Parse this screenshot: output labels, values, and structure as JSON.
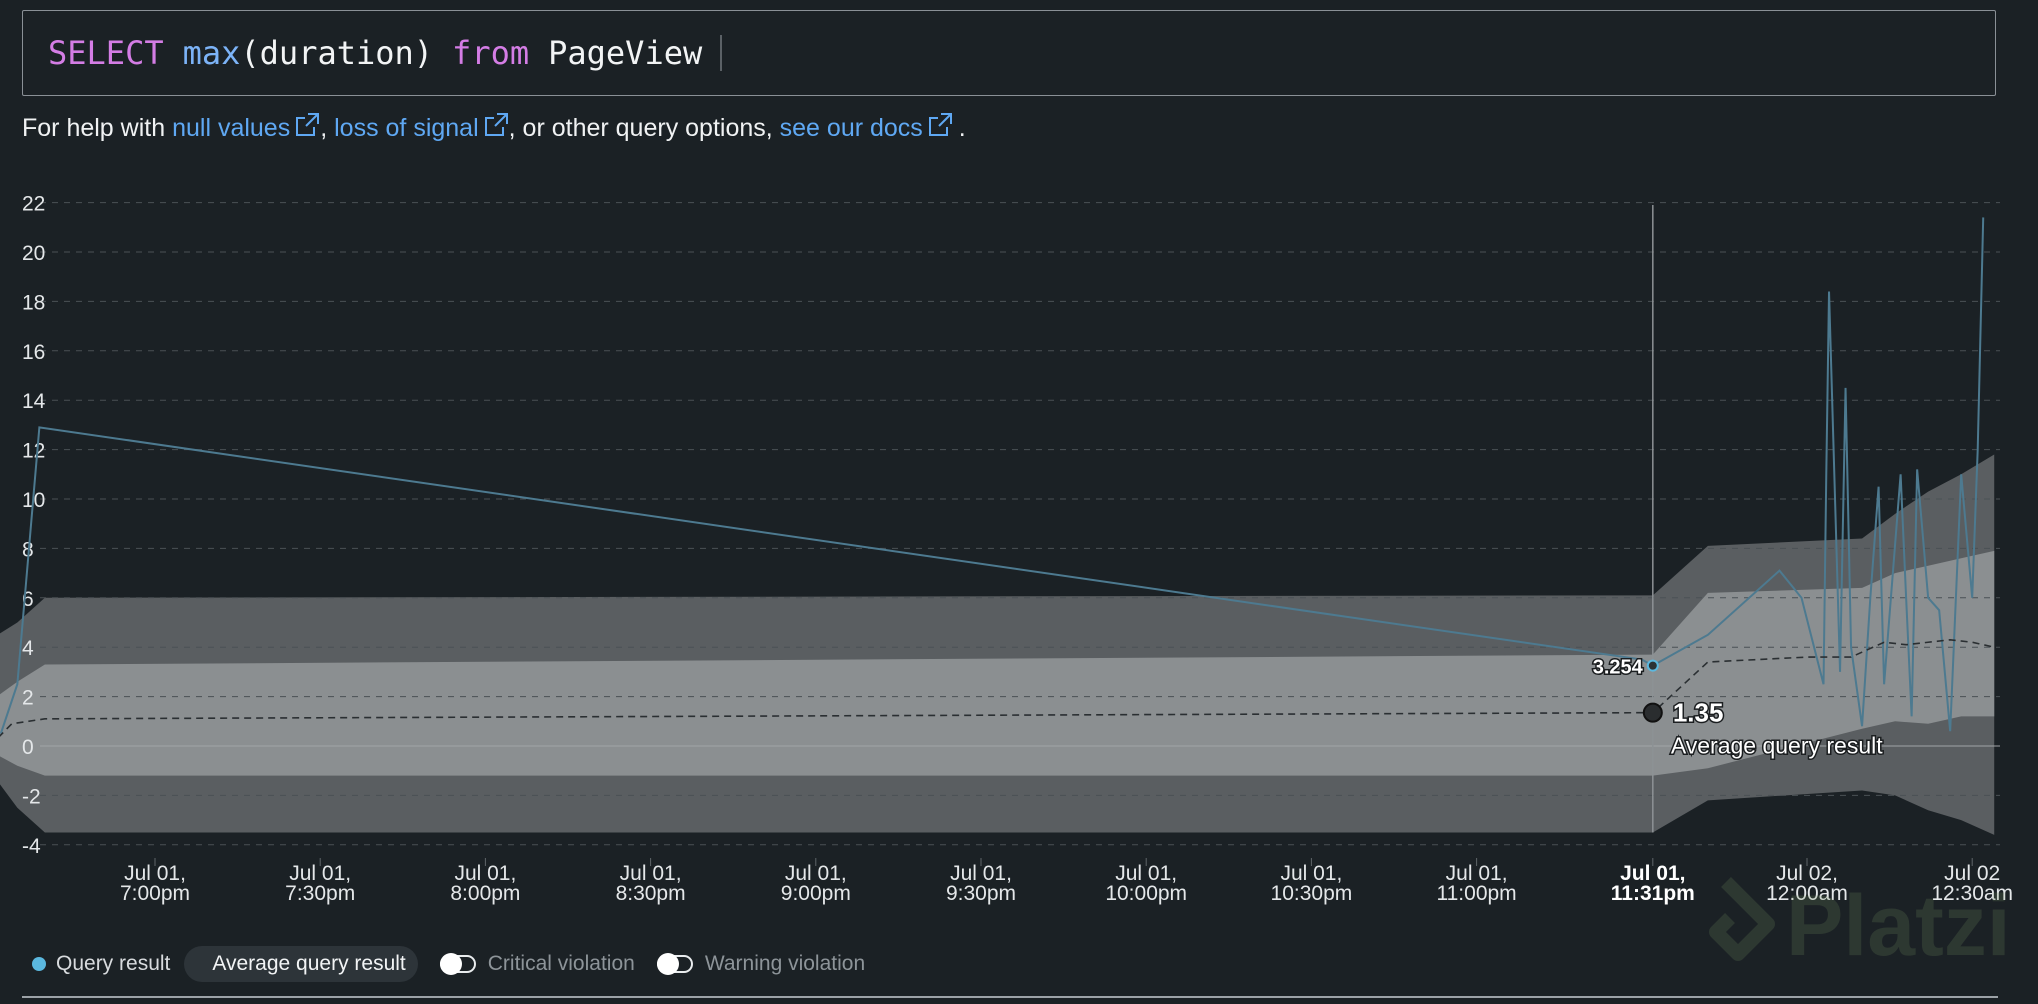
{
  "query": {
    "select": "SELECT",
    "func": "max",
    "args": "(duration)",
    "from": "from",
    "table": "PageView"
  },
  "help": {
    "prefix": "For help with",
    "link1": "null values",
    "sep1": ",",
    "link2": "loss of signal",
    "mid": ", or other query options,",
    "link3": "see our docs",
    "suffix": "."
  },
  "chart_data": {
    "type": "line",
    "ylim": [
      -5,
      22.5
    ],
    "yticks": [
      "22",
      "20",
      "18",
      "16",
      "14",
      "12",
      "10",
      "8",
      "6",
      "4",
      "2",
      "0",
      "-2",
      "-4"
    ],
    "ytick_values": [
      22,
      20,
      18,
      16,
      14,
      12,
      10,
      8,
      6,
      4,
      2,
      0,
      -2,
      -4
    ],
    "xticks": [
      {
        "t": 30,
        "l1": "Jul 01,",
        "l2": "7:00pm"
      },
      {
        "t": 60,
        "l1": "Jul 01,",
        "l2": "7:30pm"
      },
      {
        "t": 90,
        "l1": "Jul 01,",
        "l2": "8:00pm"
      },
      {
        "t": 120,
        "l1": "Jul 01,",
        "l2": "8:30pm"
      },
      {
        "t": 150,
        "l1": "Jul 01,",
        "l2": "9:00pm"
      },
      {
        "t": 180,
        "l1": "Jul 01,",
        "l2": "9:30pm"
      },
      {
        "t": 210,
        "l1": "Jul 01,",
        "l2": "10:00pm"
      },
      {
        "t": 240,
        "l1": "Jul 01,",
        "l2": "10:30pm"
      },
      {
        "t": 270,
        "l1": "Jul 01,",
        "l2": "11:00pm"
      },
      {
        "t": 302,
        "l1": "Jul 01,",
        "l2": "11:31pm",
        "highlight": true
      },
      {
        "t": 330,
        "l1": "Jul 02,",
        "l2": "12:00am"
      },
      {
        "t": 360,
        "l1": "Jul 02",
        "l2": "12:30am"
      }
    ],
    "series": [
      {
        "name": "Query result",
        "color": "#4d7a90",
        "x": [
          2,
          5,
          9,
          300,
          302,
          312,
          325,
          329,
          333,
          333.5,
          334,
          336,
          337,
          338,
          340,
          341.5,
          343,
          344,
          347,
          348,
          349,
          350,
          352,
          354,
          356,
          358,
          360,
          361,
          362
        ],
        "y": [
          0.5,
          2.5,
          12.9,
          3.5,
          3.254,
          4.5,
          7.1,
          6,
          2.5,
          11,
          18.4,
          3,
          14.5,
          4,
          0.8,
          6,
          10.5,
          2.5,
          11,
          6,
          1.2,
          11.2,
          6,
          5.5,
          0.6,
          11,
          6,
          12,
          21.4
        ]
      },
      {
        "name": "Average query result",
        "color": "#c8cdd0",
        "x": [
          0,
          4,
          10,
          302,
          312,
          330,
          338,
          344,
          348,
          352,
          356,
          360,
          364
        ],
        "y": [
          0,
          0.9,
          1.1,
          1.35,
          3.4,
          3.6,
          3.6,
          4.2,
          4.1,
          4.2,
          4.3,
          4.2,
          4.0
        ]
      }
    ],
    "tooltip": {
      "x": 302,
      "query_value": "3.254",
      "avg_value": "1.35",
      "avg_label": "Average query result"
    },
    "legend": {
      "query_result": "Query result",
      "average": "Average query result",
      "critical": "Critical violation",
      "warning": "Warning violation"
    }
  },
  "watermark": "Platzi"
}
